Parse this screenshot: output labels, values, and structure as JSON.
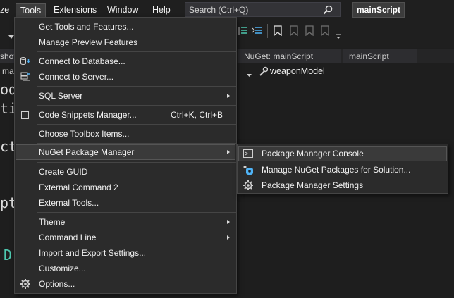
{
  "menubar": {
    "items": [
      {
        "label": "ze"
      },
      {
        "label": "Tools"
      },
      {
        "label": "Extensions"
      },
      {
        "label": "Window"
      },
      {
        "label": "Help"
      }
    ],
    "search_placeholder": "Search (Ctrl+Q)",
    "search_icon": "search-icon",
    "project_name": "mainScript"
  },
  "tabs": [
    {
      "label": "shot"
    },
    {
      "label": "NuGet: mainScript"
    },
    {
      "label": "mainScript"
    }
  ],
  "navbar": {
    "left_label": "ma",
    "member": "weaponModel"
  },
  "code_fragments": [
    "od",
    "ti",
    "ct",
    "pt",
    "D"
  ],
  "tools_menu": {
    "items": [
      {
        "label": "Get Tools and Features...",
        "icon": ""
      },
      {
        "label": "Manage Preview Features",
        "icon": ""
      },
      {
        "label": "Connect to Database...",
        "icon": "database-connect-icon"
      },
      {
        "label": "Connect to Server...",
        "icon": "server-connect-icon"
      },
      {
        "label": "SQL Server",
        "icon": "",
        "submenu": true
      },
      {
        "label": "Code Snippets Manager...",
        "icon": "snippet-icon",
        "shortcut": "Ctrl+K, Ctrl+B"
      },
      {
        "label": "Choose Toolbox Items...",
        "icon": ""
      },
      {
        "label": "NuGet Package Manager",
        "icon": "",
        "submenu": true,
        "highlighted": true
      },
      {
        "label": "Create GUID",
        "icon": ""
      },
      {
        "label": "External Command 2",
        "icon": ""
      },
      {
        "label": "External Tools...",
        "icon": ""
      },
      {
        "label": "Theme",
        "icon": "",
        "submenu": true
      },
      {
        "label": "Command Line",
        "icon": "",
        "submenu": true
      },
      {
        "label": "Import and Export Settings...",
        "icon": ""
      },
      {
        "label": "Customize...",
        "icon": ""
      },
      {
        "label": "Options...",
        "icon": "gear-icon"
      }
    ]
  },
  "nuget_submenu": {
    "items": [
      {
        "label": "Package Manager Console",
        "icon": "console-icon",
        "highlighted": true
      },
      {
        "label": "Manage NuGet Packages for Solution...",
        "icon": "nuget-icon"
      },
      {
        "label": "Package Manager Settings",
        "icon": "gear-icon"
      }
    ]
  },
  "colors": {
    "background": "#1e1e1e",
    "menu": "#2b2b2b",
    "highlight": "#3a3a3a",
    "accent": "#68217a"
  }
}
